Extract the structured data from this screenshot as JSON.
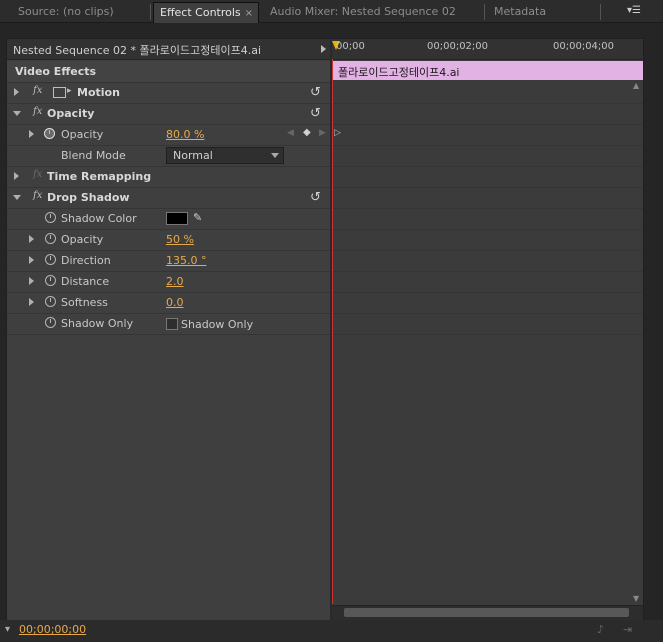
{
  "tabs": [
    {
      "label": "Source: (no clips)"
    },
    {
      "label": "Effect Controls",
      "close": "×"
    },
    {
      "label": "Audio Mixer: Nested Sequence 02"
    },
    {
      "label": "Metadata"
    }
  ],
  "sequence_header": "Nested Sequence 02 * 폴라로이드고정테이프4.ai",
  "ruler": {
    "start": "00;00",
    "mark2": "00;00;02;00",
    "mark4": "00;00;04;00"
  },
  "clip_name": "폴라로이드고정테이프4.ai",
  "section_title": "Video Effects",
  "fx_glyph": "fx",
  "reset_glyph": "↺",
  "effects": {
    "motion": {
      "name": "Motion"
    },
    "opacity": {
      "name": "Opacity",
      "prop_opacity": "Opacity",
      "opacity_value": "80.0 %",
      "blend_mode_label": "Blend Mode",
      "blend_mode_value": "Normal"
    },
    "time_remapping": {
      "name": "Time Remapping"
    },
    "drop_shadow": {
      "name": "Drop Shadow",
      "shadow_color_label": "Shadow Color",
      "shadow_color": "#000000",
      "opacity_label": "Opacity",
      "opacity_value": "50 %",
      "direction_label": "Direction",
      "direction_value": "135.0 °",
      "distance_label": "Distance",
      "distance_value": "2.0",
      "softness_label": "Softness",
      "softness_value": "0.0",
      "shadow_only_label": "Shadow Only",
      "shadow_only_checkbox_label": "Shadow Only"
    }
  },
  "footer_timecode": "00;00;00;00",
  "colors": {
    "accent_value": "#e8a94a",
    "clip_bar": "#e3b2e5",
    "playhead_line": "#cc3333",
    "playhead_marker": "#e8b400"
  }
}
